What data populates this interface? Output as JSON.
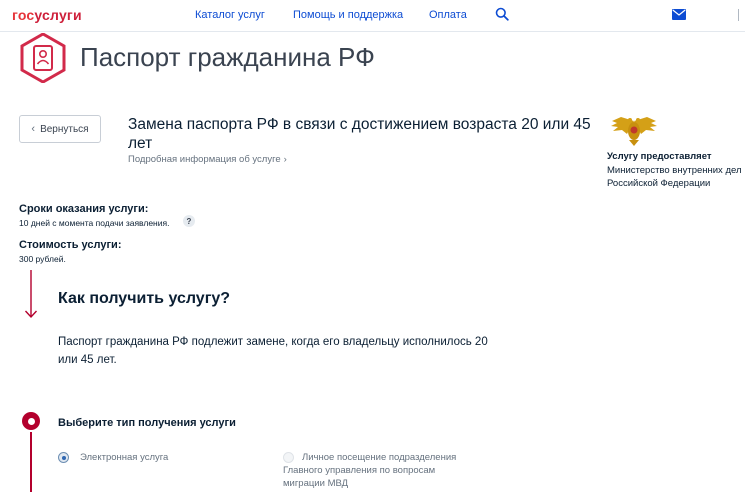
{
  "header": {
    "logo_gos": "гос",
    "logo_uslugi": "услуги",
    "nav": [
      "Каталог услуг",
      "Помощь и поддержка",
      "Оплата"
    ],
    "icons": [
      "search-icon",
      "mail-icon"
    ]
  },
  "page": {
    "title": "Паспорт гражданина РФ",
    "icon": "passport-icon"
  },
  "service": {
    "back_label": "Вернуться",
    "title": "Замена паспорта РФ в связи с достижением возраста 20 или 45 лет",
    "details_link": "Подробная информация об услуге",
    "provider_heading": "Услугу предоставляет",
    "provider_name": "Министерство внутренних дел Российской Федерации"
  },
  "terms": {
    "heading": "Сроки оказания услуги:",
    "value": "10 дней с момента подачи заявления.",
    "help": "?"
  },
  "cost": {
    "heading": "Стоимость услуги:",
    "value": "300 рублей."
  },
  "how": {
    "title": "Как получить услугу?",
    "description": "Паспорт гражданина РФ подлежит замене, когда его владельцу исполнилось 20 или 45 лет."
  },
  "step": {
    "title": "Выберите тип получения услуги",
    "options": [
      {
        "label": "Электронная услуга",
        "selected": true
      },
      {
        "label": "Личное посещение подразделения Главного управления по вопросам миграции МВД",
        "selected": false
      }
    ]
  },
  "colors": {
    "brand_red": "#e6343a",
    "accent_crimson": "#b3002d",
    "link_blue": "#0d4cd3"
  }
}
